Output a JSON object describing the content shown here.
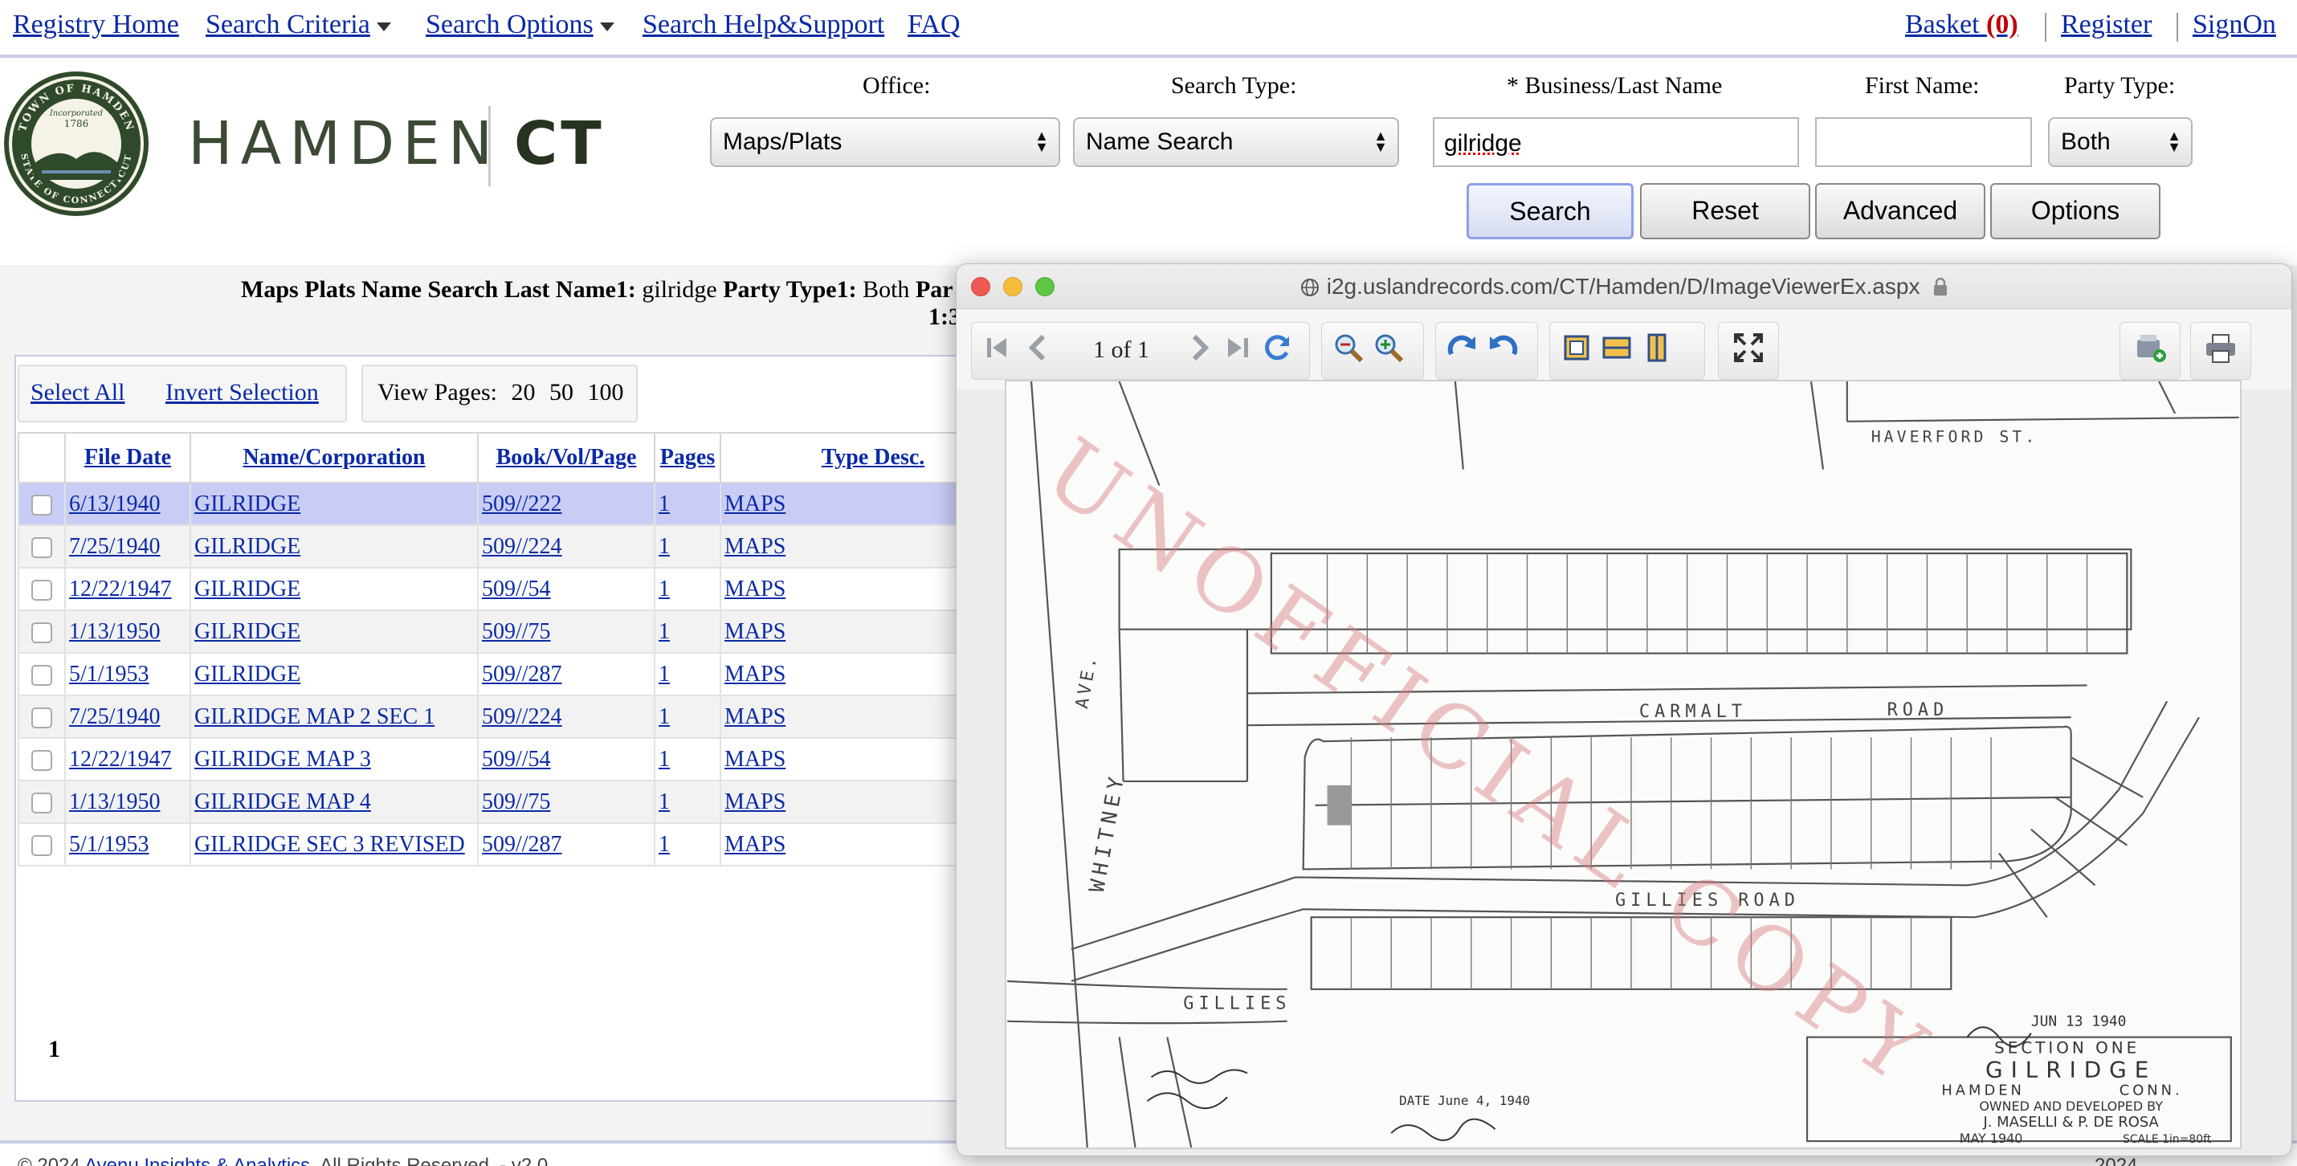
{
  "nav": {
    "registry_home": "Registry Home",
    "search_criteria": "Search Criteria",
    "search_options": "Search Options",
    "search_help": "Search Help&Support",
    "faq": "FAQ",
    "basket_label": "Basket",
    "basket_count": "(0)",
    "register": "Register",
    "signon": "SignOn"
  },
  "header": {
    "logo_town": "HAMDEN",
    "logo_state": "CT",
    "seal_top": "TOWN OF HAMDEN",
    "seal_bottom": "STATE OF CONNECTICUT",
    "seal_incorporated": "Incorporated",
    "seal_year": "1786"
  },
  "search_form": {
    "office_label": "Office:",
    "office_value": "Maps/Plats",
    "search_type_label": "Search Type:",
    "search_type_value": "Name Search",
    "last_name_label": "* Business/Last Name",
    "last_name_value": "gilridge",
    "first_name_label": "First Name:",
    "first_name_value": "",
    "party_type_label": "Party Type:",
    "party_type_value": "Both",
    "buttons": {
      "search": "Search",
      "reset": "Reset",
      "advanced": "Advanced",
      "options": "Options"
    }
  },
  "summary": {
    "prefix": "Maps Plats Name Search Last Name1:",
    "last_name": "gilridge",
    "party_label": "Party Type1:",
    "party_value": "Both",
    "party_label_cut": "Par",
    "line2": "1:3"
  },
  "results_toolbar": {
    "select_all": "Select All",
    "invert_selection": "Invert Selection",
    "view_pages_label": "View Pages:",
    "view_pages_options": [
      "20",
      "50",
      "100"
    ]
  },
  "table": {
    "headers": [
      "File Date",
      "Name/Corporation",
      "Book/Vol/Page",
      "Pages",
      "Type Desc."
    ],
    "rows": [
      {
        "date": "6/13/1940",
        "name": "GILRIDGE",
        "book": "509//222",
        "pages": "1",
        "type": "MAPS"
      },
      {
        "date": "7/25/1940",
        "name": "GILRIDGE",
        "book": "509//224",
        "pages": "1",
        "type": "MAPS"
      },
      {
        "date": "12/22/1947",
        "name": "GILRIDGE",
        "book": "509//54",
        "pages": "1",
        "type": "MAPS"
      },
      {
        "date": "1/13/1950",
        "name": "GILRIDGE",
        "book": "509//75",
        "pages": "1",
        "type": "MAPS"
      },
      {
        "date": "5/1/1953",
        "name": "GILRIDGE",
        "book": "509//287",
        "pages": "1",
        "type": "MAPS"
      },
      {
        "date": "7/25/1940",
        "name": "GILRIDGE MAP 2 SEC 1",
        "book": "509//224",
        "pages": "1",
        "type": "MAPS"
      },
      {
        "date": "12/22/1947",
        "name": "GILRIDGE MAP 3",
        "book": "509//54",
        "pages": "1",
        "type": "MAPS"
      },
      {
        "date": "1/13/1950",
        "name": "GILRIDGE MAP 4",
        "book": "509//75",
        "pages": "1",
        "type": "MAPS"
      },
      {
        "date": "5/1/1953",
        "name": "GILRIDGE SEC 3 REVISED",
        "book": "509//287",
        "pages": "1",
        "type": "MAPS"
      }
    ],
    "selected_row": 0
  },
  "pagination": {
    "current_page": "1"
  },
  "footer": {
    "copyright": "© 2024",
    "company": "Avenu Insights & Analytics",
    "rights": ". All Rights Reserved. - v2.0",
    "year": "2024"
  },
  "viewer": {
    "url": "i2g.uslandrecords.com/CT/Hamden/D/ImageViewerEx.aspx",
    "page_indicator": "1 of 1",
    "map": {
      "watermark": "UNOFFICIAL COPY",
      "street_haverford": "HAVERFORD ST.",
      "street_carmalt": "CARMALT",
      "street_road": "ROAD",
      "street_gillies_road": "GILLIES ROAD",
      "street_gillies": "GILLIES",
      "street_whitney": "WHITNEY",
      "street_ave": "AVE.",
      "title_section": "SECTION ONE",
      "title_name": "GILRIDGE",
      "title_town": "HAMDEN",
      "title_state": "CONN.",
      "title_owned": "OWNED AND DEVELOPED BY",
      "title_owners": "J. MASELLI & P. DE ROSA",
      "title_date": "MAY 1940",
      "title_scale": "SCALE 1in=80ft",
      "stamp": "JUN 13 1940",
      "date_note": "DATE June 4, 1940"
    }
  }
}
